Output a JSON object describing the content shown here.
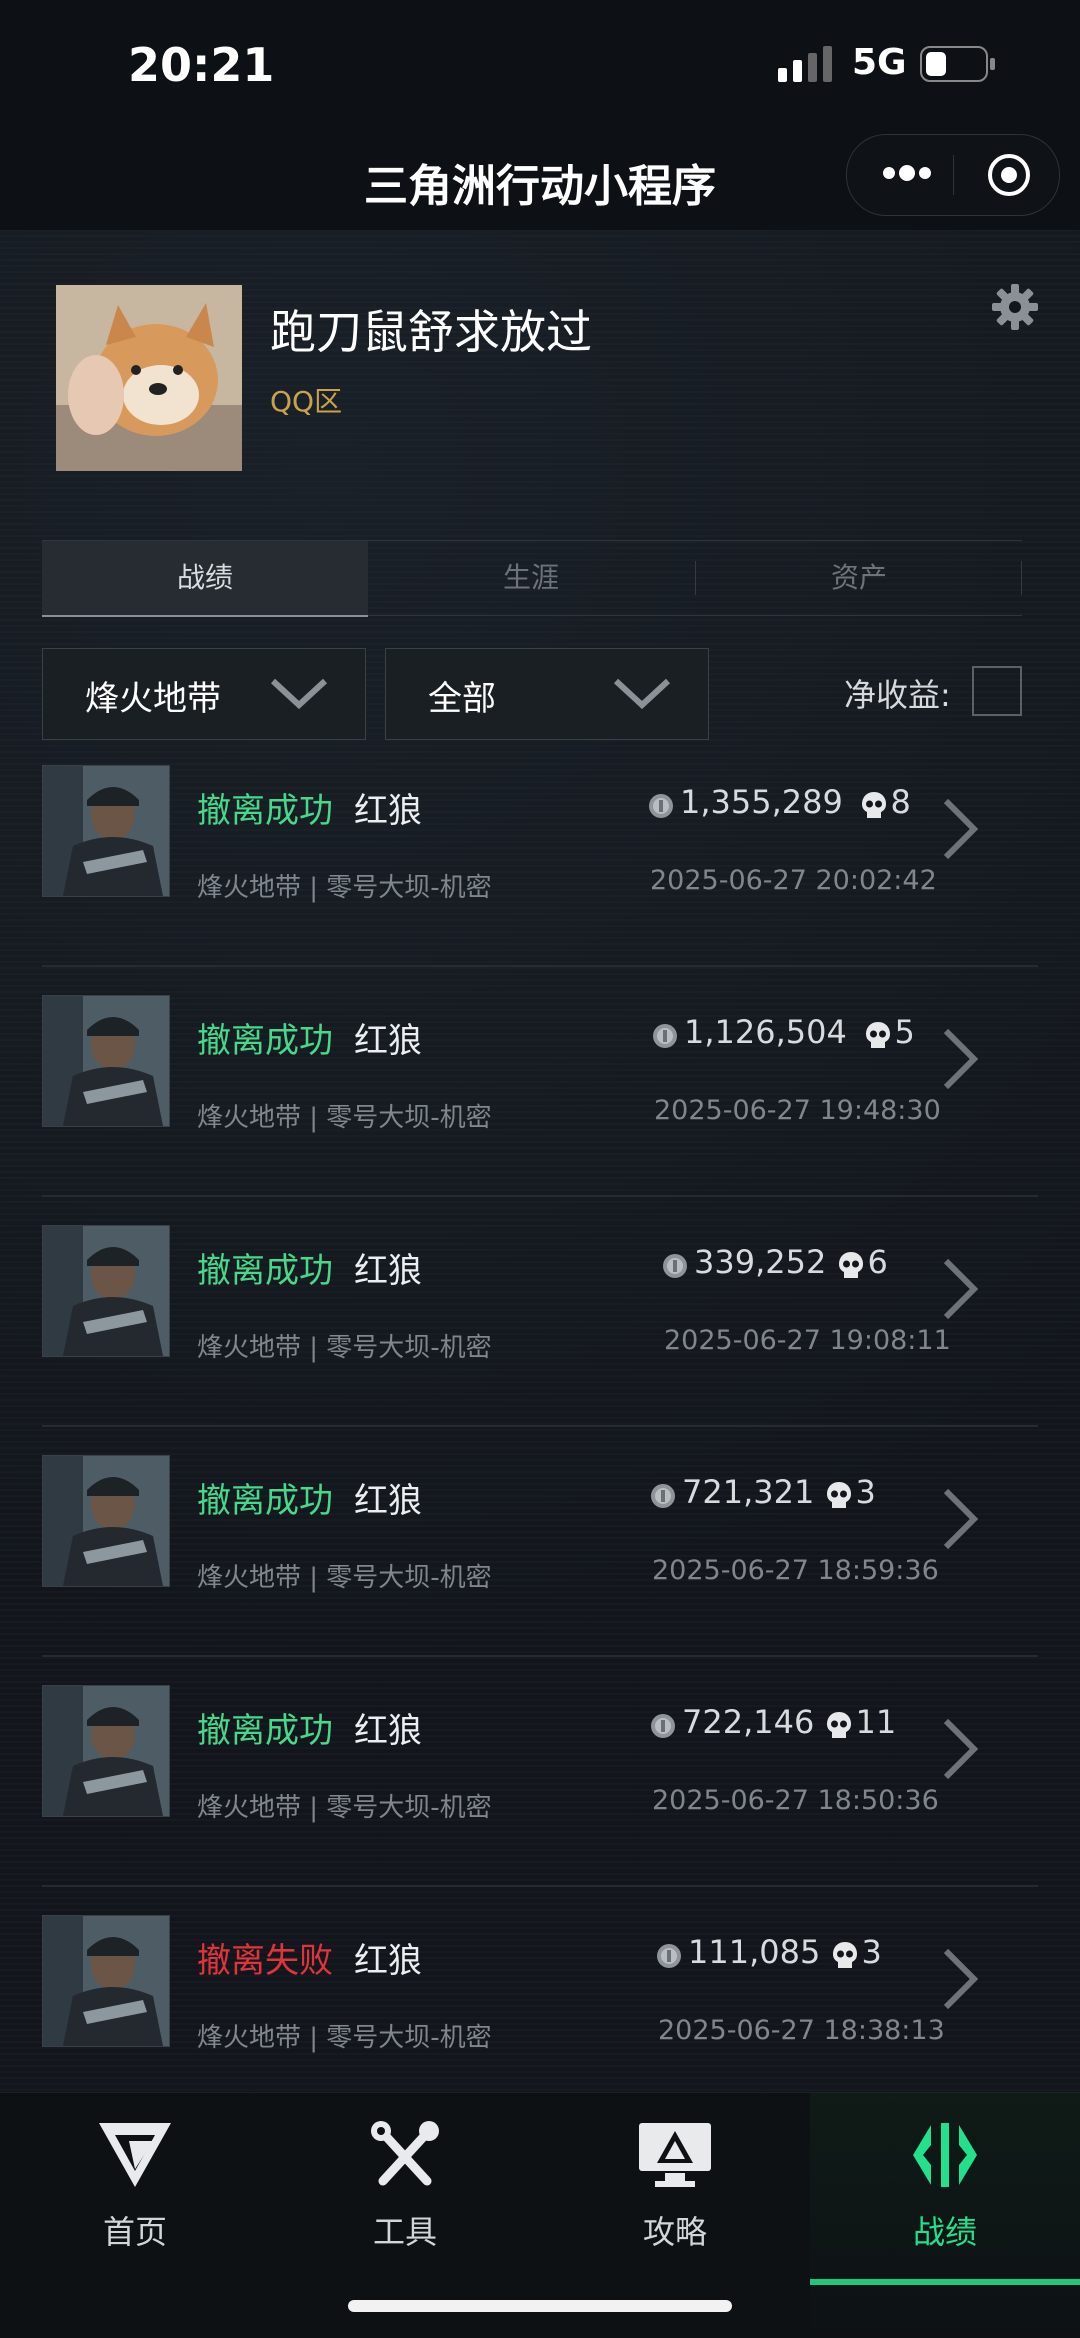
{
  "status_bar": {
    "time": "20:21",
    "network": "5G"
  },
  "nav": {
    "title": "三角洲行动小程序"
  },
  "profile": {
    "username": "跑刀鼠舒求放过",
    "region": "QQ区"
  },
  "tabs": [
    {
      "label": "战绩",
      "active": true
    },
    {
      "label": "生涯",
      "active": false
    },
    {
      "label": "资产",
      "active": false
    }
  ],
  "filters": {
    "mode": "烽火地带",
    "scope": "全部",
    "net_income_label": "净收益:",
    "net_income_checked": false
  },
  "records": [
    {
      "result": "撤离成功",
      "status": "success",
      "operator": "红狼",
      "value": "1,355,289",
      "kills": "8",
      "map": "烽火地带 | 零号大坝-机密",
      "time": "2025-06-27 20:02:42"
    },
    {
      "result": "撤离成功",
      "status": "success",
      "operator": "红狼",
      "value": "1,126,504",
      "kills": "5",
      "map": "烽火地带 | 零号大坝-机密",
      "time": "2025-06-27 19:48:30"
    },
    {
      "result": "撤离成功",
      "status": "success",
      "operator": "红狼",
      "value": "339,252",
      "kills": "6",
      "map": "烽火地带 | 零号大坝-机密",
      "time": "2025-06-27 19:08:11"
    },
    {
      "result": "撤离成功",
      "status": "success",
      "operator": "红狼",
      "value": "721,321",
      "kills": "3",
      "map": "烽火地带 | 零号大坝-机密",
      "time": "2025-06-27 18:59:36"
    },
    {
      "result": "撤离成功",
      "status": "success",
      "operator": "红狼",
      "value": "722,146",
      "kills": "11",
      "map": "烽火地带 | 零号大坝-机密",
      "time": "2025-06-27 18:50:36"
    },
    {
      "result": "撤离失败",
      "status": "fail",
      "operator": "红狼",
      "value": "111,085",
      "kills": "3",
      "map": "烽火地带 | 零号大坝-机密",
      "time": "2025-06-27 18:38:13"
    }
  ],
  "bottom_tabs": [
    {
      "label": "首页",
      "icon": "delta-logo-icon",
      "active": false
    },
    {
      "label": "工具",
      "icon": "tools-icon",
      "active": false
    },
    {
      "label": "攻略",
      "icon": "monitor-guide-icon",
      "active": false
    },
    {
      "label": "战绩",
      "icon": "battle-record-icon",
      "active": true
    }
  ],
  "colors": {
    "success": "#47d88a",
    "fail": "#e0343b",
    "accent": "#22e08b",
    "region": "#c9a24b"
  }
}
